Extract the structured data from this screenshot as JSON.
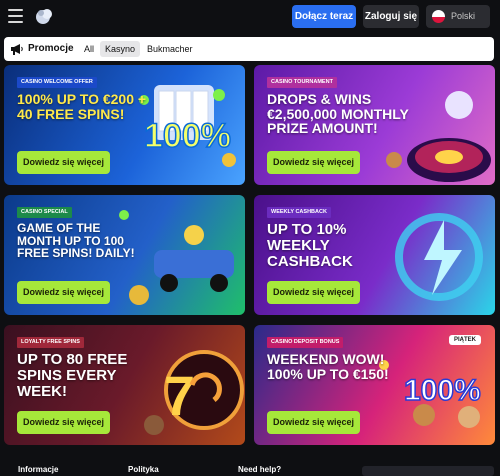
{
  "header": {
    "join_label": "Dołącz teraz",
    "login_label": "Zaloguj się",
    "language": "Polski"
  },
  "tabs": {
    "title": "Promocje",
    "items": [
      "All",
      "Kasyno",
      "Bukmacher"
    ],
    "active": "Kasyno"
  },
  "cards": [
    {
      "tag": "Casino Welcome Offer",
      "headline": "100% UP TO €200 + 40 FREE SPINS!",
      "cta": "Dowiedz się więcej"
    },
    {
      "tag": "Casino Tournament",
      "headline": "DROPS & WINS €2,500,000 MONTHLY PRIZE AMOUNT!",
      "cta": "Dowiedz się więcej"
    },
    {
      "tag": "Casino Special",
      "headline": "GAME OF THE MONTH UP TO 100 FREE SPINS! DAILY!",
      "cta": "Dowiedz się więcej"
    },
    {
      "tag": "Weekly Cashback",
      "headline": "UP TO 10% WEEKLY CASHBACK",
      "cta": "Dowiedz się więcej"
    },
    {
      "tag": "Loyalty Free Spins",
      "headline": "UP TO 80 FREE SPINS EVERY WEEK!",
      "cta": "Dowiedz się więcej"
    },
    {
      "tag": "Casino Deposit Bonus",
      "headline": "WEEKEND WOW! 100% UP TO €150!",
      "cta": "Dowiedz się więcej",
      "badge": "PIĄTEK"
    }
  ],
  "footer": {
    "col1": "Informacje",
    "col2": "Polityka",
    "col3": "Need help?"
  },
  "colors": {
    "accent_green": "#a6e83a",
    "join_blue": "#2a6ef0"
  }
}
